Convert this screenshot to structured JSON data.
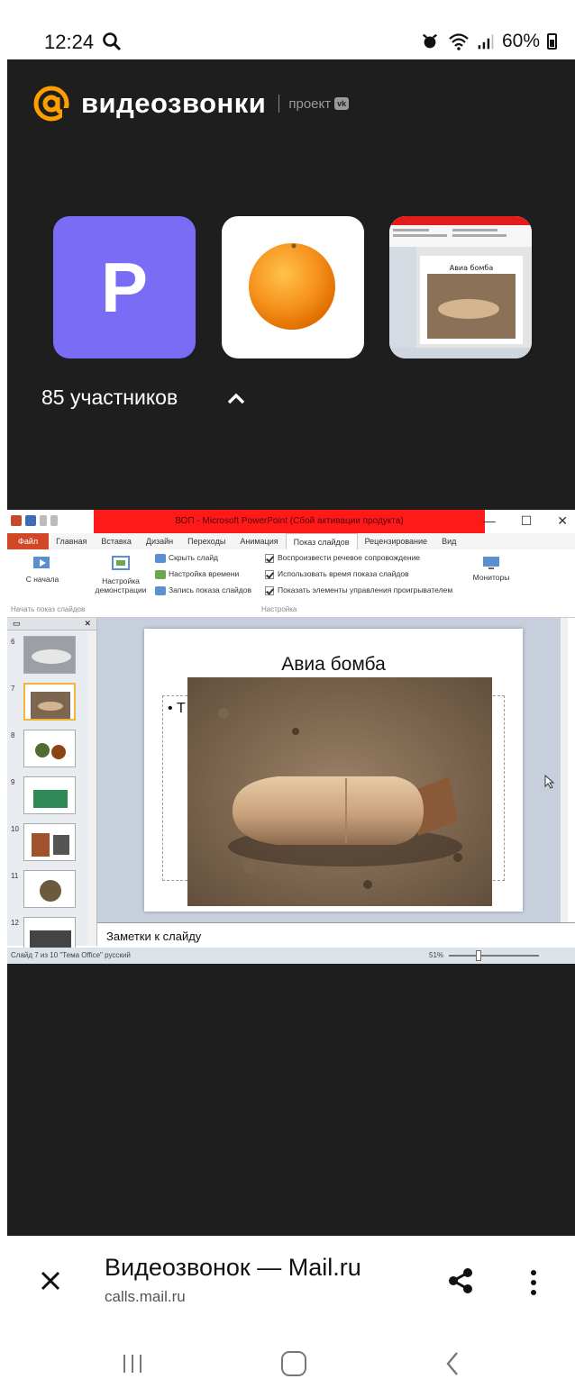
{
  "status_bar": {
    "time": "12:24",
    "battery": "60%"
  },
  "header": {
    "brand": "видеозвонки",
    "project": "проект",
    "vk_badge": "vk"
  },
  "participants": {
    "avatar_letter": "P",
    "count_label": "85 участников"
  },
  "shared_screen": {
    "window_title": "ВОП - Microsoft PowerPoint (Сбой активации продукта)",
    "tabs": [
      "Файл",
      "Главная",
      "Вставка",
      "Дизайн",
      "Переходы",
      "Анимация",
      "Показ слайдов",
      "Рецензирование",
      "Вид"
    ],
    "active_tab": "Показ слайдов",
    "ribbon": {
      "from_start": "С начала",
      "group_start": "Начать показ слайдов",
      "setup": "Настройка демонстрации",
      "hide_slide": "Скрыть слайд",
      "timing": "Настройка времени",
      "record": "Запись показа слайдов",
      "check_narration": "Воспроизвести речевое сопровождение",
      "check_timings": "Использовать время показа слайдов",
      "check_controls": "Показать элементы управления проигрывателем",
      "group_setup": "Настройка",
      "monitors": "Мониторы"
    },
    "thumbnails": [
      "6",
      "7",
      "8",
      "9",
      "10",
      "11",
      "12"
    ],
    "selected_slide": "7",
    "slide_title": "Авиа бомба",
    "slide_bullet": "• Т",
    "notes_placeholder": "Заметки к слайду",
    "status_left": "Слайд 7 из 10   \"Тема Office\"   русский",
    "zoom": "51%"
  },
  "mini_slide_title": "Авиа бомба",
  "browser": {
    "title": "Видеозвонок — Mail.ru",
    "host": "calls.mail.ru"
  },
  "colors": {
    "brand_orange": "#ff9e00",
    "avatar_purple": "#7b6cf6",
    "dark_bg": "#1e1e1e",
    "title_red": "#ff1a1a"
  }
}
